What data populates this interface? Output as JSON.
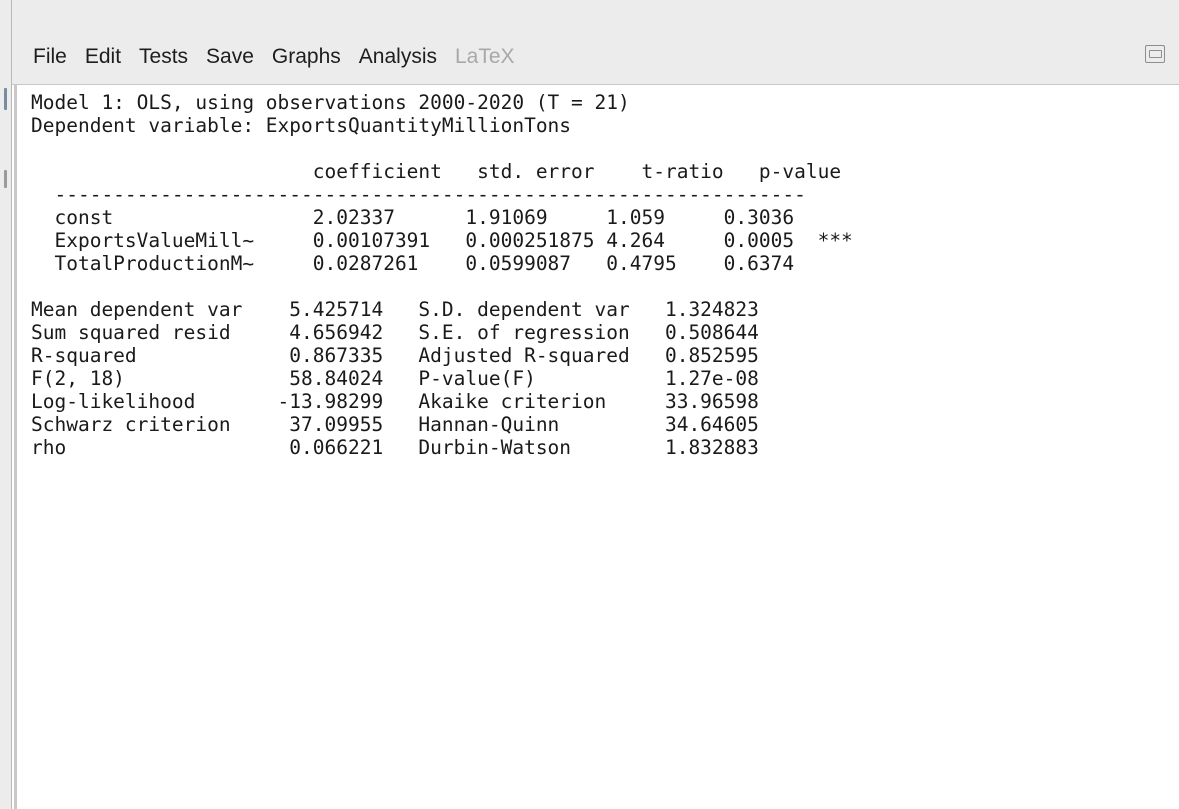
{
  "menu": {
    "items": [
      {
        "label": "File",
        "enabled": true
      },
      {
        "label": "Edit",
        "enabled": true
      },
      {
        "label": "Tests",
        "enabled": true
      },
      {
        "label": "Save",
        "enabled": true
      },
      {
        "label": "Graphs",
        "enabled": true
      },
      {
        "label": "Analysis",
        "enabled": true
      },
      {
        "label": "LaTeX",
        "enabled": false
      }
    ],
    "window_icon": "window-restore-icon"
  },
  "model": {
    "title": "Model 1: OLS, using observations 2000-2020 (T = 21)",
    "dependent": "Dependent variable: ExportsQuantityMillionTons",
    "columns": [
      "coefficient",
      "std. error",
      "t-ratio",
      "p-value"
    ],
    "rows": [
      {
        "name": "const",
        "coefficient": "2.02337",
        "std_error": "1.91069",
        "t_ratio": "1.059",
        "p_value": "0.3036",
        "stars": ""
      },
      {
        "name": "ExportsValueMill~",
        "coefficient": "0.00107391",
        "std_error": "0.000251875",
        "t_ratio": "4.264",
        "p_value": "0.0005",
        "stars": "***"
      },
      {
        "name": "TotalProductionM~",
        "coefficient": "0.0287261",
        "std_error": "0.0599087",
        "t_ratio": "0.4795",
        "p_value": "0.6374",
        "stars": ""
      }
    ],
    "stats": [
      {
        "label1": "Mean dependent var",
        "value1": "5.425714",
        "label2": "S.D. dependent var",
        "value2": "1.324823"
      },
      {
        "label1": "Sum squared resid",
        "value1": "4.656942",
        "label2": "S.E. of regression",
        "value2": "0.508644"
      },
      {
        "label1": "R-squared",
        "value1": "0.867335",
        "label2": "Adjusted R-squared",
        "value2": "0.852595"
      },
      {
        "label1": "F(2, 18)",
        "value1": "58.84024",
        "label2": "P-value(F)",
        "value2": "1.27e-08"
      },
      {
        "label1": "Log-likelihood",
        "value1": "-13.98299",
        "label2": "Akaike criterion",
        "value2": "33.96598"
      },
      {
        "label1": "Schwarz criterion",
        "value1": "37.09955",
        "label2": "Hannan-Quinn",
        "value2": "34.64605"
      },
      {
        "label1": "rho",
        "value1": "0.066221",
        "label2": "Durbin-Watson",
        "value2": "1.832883"
      }
    ]
  }
}
